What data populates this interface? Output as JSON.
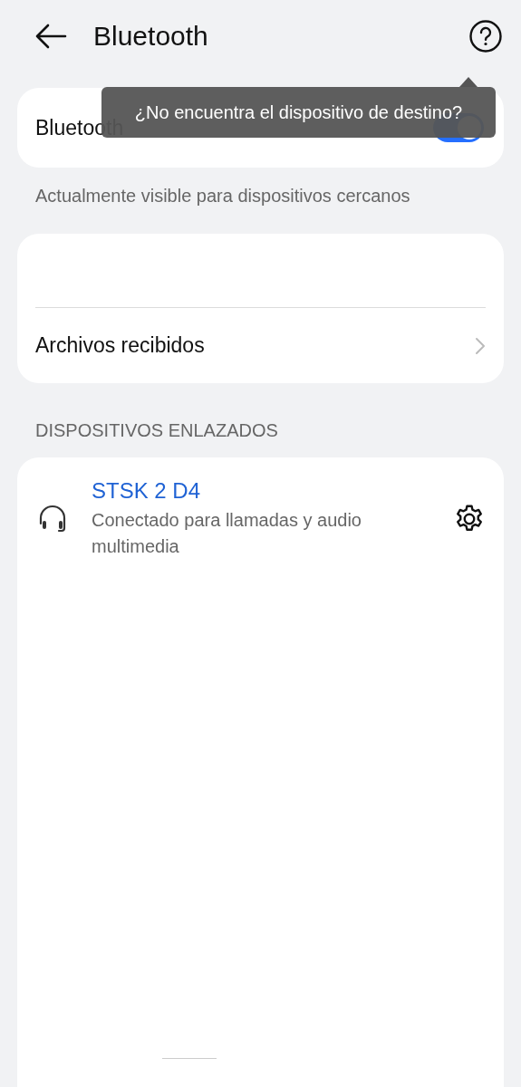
{
  "header": {
    "title": "Bluetooth"
  },
  "bluetooth_toggle": {
    "label": "Bluetooth",
    "on": true
  },
  "tooltip": {
    "text": "¿No encuentra el dispositivo de destino?"
  },
  "visibility_note": "Actualmente visible para dispositivos cercanos",
  "files": {
    "label": "Archivos recibidos"
  },
  "paired_section": {
    "title": "DISPOSITIVOS ENLAZADOS",
    "devices": [
      {
        "name": "STSK 2 D4",
        "status": "Conectado para llamadas y audio multimedia",
        "connected": true
      }
    ]
  }
}
